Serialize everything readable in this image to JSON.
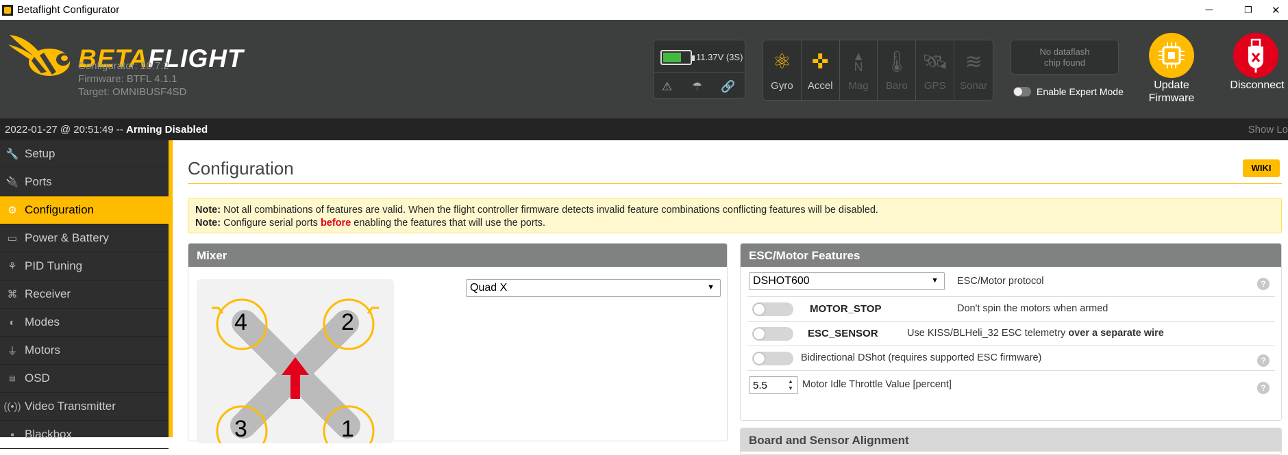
{
  "window": {
    "title": "Betaflight Configurator",
    "minimize": "─",
    "restore": "❐",
    "close": "✕"
  },
  "header": {
    "brand_first": "BETA",
    "brand_second": "FLIGHT",
    "configurator_version": "Configurator: 10.7.2",
    "firmware_version": "Firmware: BTFL 4.1.1",
    "target": "Target: OMNIBUSF4SD",
    "battery": {
      "voltage": "11.37V (3S)",
      "level": 0.6,
      "color": "#44b940"
    },
    "status_icons": [
      "warning-icon",
      "parachute-icon",
      "link-icon"
    ],
    "sensors": [
      {
        "name": "Gyro",
        "active": true,
        "icon": "gyro-icon"
      },
      {
        "name": "Accel",
        "active": true,
        "icon": "accel-icon"
      },
      {
        "name": "Mag",
        "active": false,
        "icon": "mag-icon"
      },
      {
        "name": "Baro",
        "active": false,
        "icon": "baro-icon"
      },
      {
        "name": "GPS",
        "active": false,
        "icon": "gps-icon"
      },
      {
        "name": "Sonar",
        "active": false,
        "icon": "sonar-icon"
      }
    ],
    "dataflash_line1": "No dataflash",
    "dataflash_line2": "chip found",
    "expert_mode_label": "Enable Expert Mode",
    "update_firmware_line1": "Update",
    "update_firmware_line2": "Firmware",
    "disconnect_label": "Disconnect"
  },
  "status": {
    "datetime": "2022-01-27 @ 20:51:49 -- ",
    "state": "Arming Disabled",
    "show_log": "Show Lo"
  },
  "sidebar": {
    "items": [
      {
        "label": "Setup",
        "icon": "wrench-icon"
      },
      {
        "label": "Ports",
        "icon": "plug-icon"
      },
      {
        "label": "Configuration",
        "icon": "gear-icon",
        "active": true
      },
      {
        "label": "Power & Battery",
        "icon": "battery-icon"
      },
      {
        "label": "PID Tuning",
        "icon": "sitemap-icon"
      },
      {
        "label": "Receiver",
        "icon": "receiver-icon"
      },
      {
        "label": "Modes",
        "icon": "toggle-icon"
      },
      {
        "label": "Motors",
        "icon": "motor-icon"
      },
      {
        "label": "OSD",
        "icon": "osd-icon"
      },
      {
        "label": "Video Transmitter",
        "icon": "broadcast-icon"
      },
      {
        "label": "Blackbox",
        "icon": "blackbox-icon"
      }
    ]
  },
  "main": {
    "title": "Configuration",
    "wiki": "WIKI",
    "note1_label": "Note:",
    "note1_text": " Not all combinations of features are valid. When the flight controller firmware detects invalid feature combinations conflicting features will be disabled.",
    "note2_label": "Note:",
    "note2_text_a": " Configure serial ports ",
    "note2_highlight": "before",
    "note2_text_b": " enabling the features that will use the ports."
  },
  "mixer": {
    "title": "Mixer",
    "selected": "Quad X",
    "motor_numbers": [
      "4",
      "2",
      "3",
      "1"
    ]
  },
  "esc": {
    "title": "ESC/Motor Features",
    "protocol_selected": "DSHOT600",
    "protocol_label": "ESC/Motor protocol",
    "motor_stop_name": "MOTOR_STOP",
    "motor_stop_desc": "Don't spin the motors when armed",
    "esc_sensor_name": "ESC_SENSOR",
    "esc_sensor_desc": "Use KISS/BLHeli_32 ESC telemetry ",
    "esc_sensor_desc_bold": "over a separate wire",
    "bidir_desc": "Bidirectional DShot (requires supported ESC firmware)",
    "idle_value": "5.5",
    "idle_label": "Motor Idle Throttle Value [percent]",
    "help": "?"
  },
  "next_panel": {
    "title": "Board and Sensor Alignment"
  }
}
